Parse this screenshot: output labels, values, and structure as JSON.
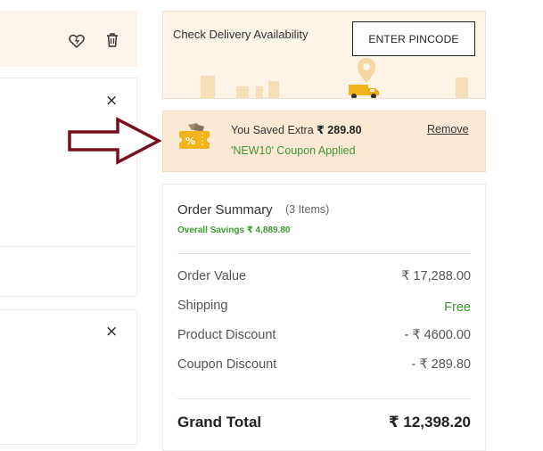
{
  "delivery": {
    "label": "Check Delivery Availability",
    "button_label": "ENTER PINCODE"
  },
  "coupon": {
    "saved_prefix": "You Saved Extra ",
    "saved_amount": "₹ 289.80",
    "remove_label": "Remove",
    "applied_text": "'NEW10' Coupon Applied",
    "icon": "coupon-ticket-icon"
  },
  "summary": {
    "title": "Order Summary",
    "count": "(3 Items)",
    "overall_savings": "Overall Savings ₹ 4,889.80",
    "rows": [
      {
        "label": "Order Value",
        "value": "₹ 17,288.00"
      },
      {
        "label": "Shipping",
        "value": "Free"
      },
      {
        "label": "Product Discount",
        "value": "- ₹ 4600.00"
      },
      {
        "label": "Coupon Discount",
        "value": "- ₹ 289.80"
      }
    ],
    "grand_label": "Grand Total",
    "grand_value": "₹ 12,398.20"
  },
  "left": {
    "close_glyph": "×",
    "icons": [
      "wishlist-heart-icon",
      "delete-trash-icon"
    ]
  },
  "colors": {
    "accent_green": "#3c9a2e",
    "panel_beige": "#fdf3e7",
    "coupon_bg": "#fbe9d6",
    "arrow": "#7a0f1c",
    "truck_yellow": "#f2b419"
  }
}
